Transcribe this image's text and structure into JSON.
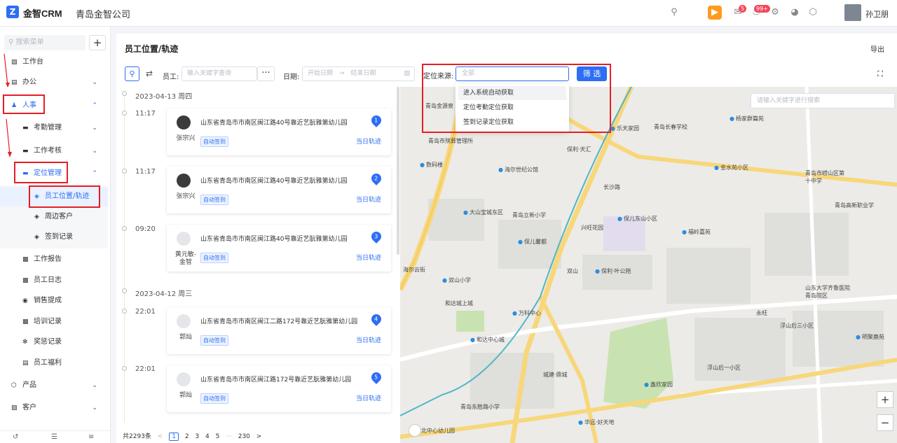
{
  "header": {
    "logo_icon": "Z",
    "logo_text": "金智CRM",
    "company": "青岛金智公司",
    "badge_message": "5",
    "badge_notify": "99+",
    "user_name": "孙卫朋"
  },
  "sidebar": {
    "search_placeholder": "搜索菜单",
    "add": "+",
    "items": [
      {
        "label": "工作台"
      },
      {
        "label": "办公"
      },
      {
        "label": "人事"
      },
      {
        "label": "考勤管理"
      },
      {
        "label": "工作考核"
      },
      {
        "label": "定位管理"
      },
      {
        "label": "员工位置/轨迹"
      },
      {
        "label": "周边客户"
      },
      {
        "label": "签到记录"
      },
      {
        "label": "工作报告"
      },
      {
        "label": "员工日志"
      },
      {
        "label": "销售提成"
      },
      {
        "label": "培训记录"
      },
      {
        "label": "奖惩记录"
      },
      {
        "label": "员工福利"
      },
      {
        "label": "产品"
      },
      {
        "label": "客户"
      }
    ]
  },
  "main": {
    "title": "员工位置/轨迹",
    "export": "导出",
    "employee_label": "员工:",
    "employee_placeholder": "输入关键字查询",
    "date_label": "日期:",
    "start_date": "开始日期",
    "date_sep": "→",
    "end_date": "结束日期",
    "source_label": "定位来源:",
    "source_placeholder": "全部",
    "filter_button": "筛 选",
    "source_options": [
      "进入系统自动获取",
      "定位考勤定位获取",
      "签到记录定位获取"
    ]
  },
  "timeline": {
    "groups": [
      {
        "date": "2023-04-13  周四"
      },
      {
        "date": "2023-04-12  周三"
      }
    ],
    "records": [
      {
        "time": "11:17",
        "name": "张宗兴",
        "address": "山东省青岛市市南区闽江路40号靠近艺朊雅第幼儿园",
        "tag": "自动签到",
        "link": "当日轨迹",
        "pin": "1"
      },
      {
        "time": "11:17",
        "name": "张宗兴",
        "address": "山东省青岛市市南区闽江路40号靠近艺朊雅第幼儿园",
        "tag": "自动签到",
        "link": "当日轨迹",
        "pin": "2"
      },
      {
        "time": "09:20",
        "name": "黄元敏-金智",
        "address": "山东省青岛市市南区闽江路40号靠近艺朊雅第幼儿园",
        "tag": "自动签到",
        "link": "当日轨迹",
        "pin": "3"
      },
      {
        "time": "22:01",
        "name": "郭灿",
        "address": "山东省青岛市市南区闽江二路172号靠近艺朊雅第幼儿园",
        "tag": "自动签到",
        "link": "当日轨迹",
        "pin": "4"
      },
      {
        "time": "22:01",
        "name": "郭灿",
        "address": "山东省青岛市市南区闽江路172号靠近艺朊雅第幼儿园",
        "tag": "自动签到",
        "link": "当日轨迹",
        "pin": "5"
      }
    ]
  },
  "pager": {
    "total": "共2293条",
    "prev": "<",
    "pages": [
      "1",
      "2",
      "3",
      "4",
      "5"
    ],
    "ellipsis": "···",
    "last": "230",
    "next": ">"
  },
  "map": {
    "search_placeholder": "请输入关键字进行搜索",
    "zoom_in": "+",
    "zoom_out": "−",
    "labels": [
      "青岛金源泉",
      "青岛市殡葬管理所",
      "数码楼",
      "海尔世纪公馆",
      "保利·天汇",
      "乐天家园",
      "青岛长春学校",
      "杨家群篇苑",
      "金水苑小区",
      "长沙路",
      "青岛市崂山区第十中学",
      "青岛高新职业学",
      "大山宝城东区",
      "青岛立新小学",
      "兴旺花园",
      "保儿东山小区",
      "福岭嘉苑",
      "保儿馨都",
      "海尔云街",
      "双山",
      "保利·叶公陪",
      "双山小学",
      "和达城上城",
      "万科中心",
      "永旺",
      "山东大学齐鲁医院青岛院区",
      "浮山后三小区",
      "和达中心城",
      "城建·鼎城",
      "浮山后一小区",
      "鑫欣家园",
      "青岛东胜路小学",
      "华远·好天地",
      "市北中心幼儿园",
      "明聚鹿苑"
    ]
  }
}
